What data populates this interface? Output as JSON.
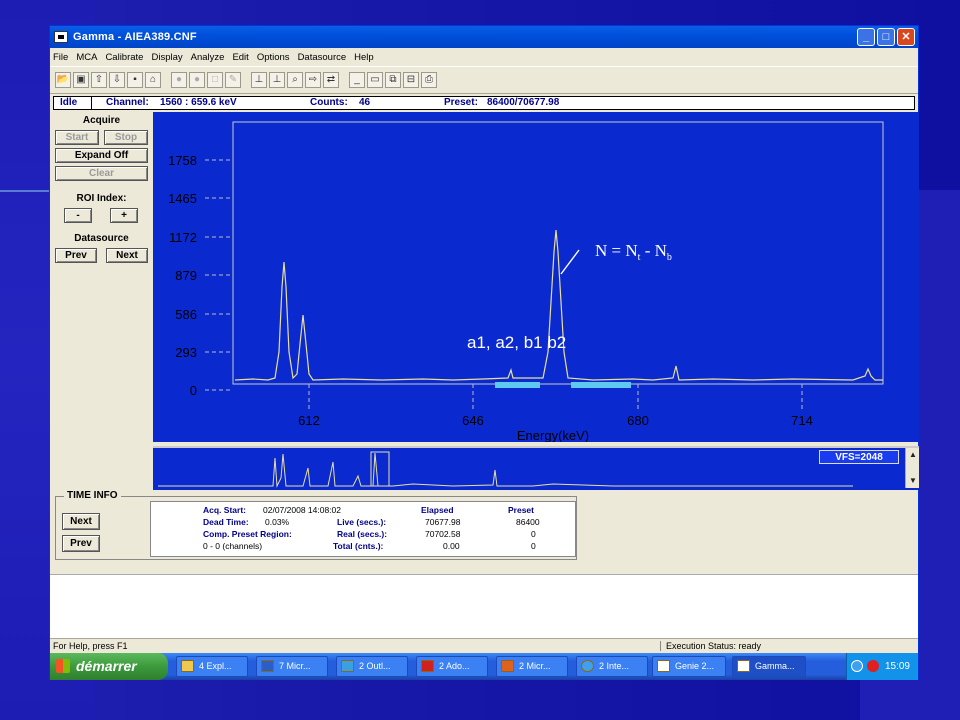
{
  "window": {
    "title": "Gamma - AIEA389.CNF",
    "controls": [
      "_",
      "□",
      "✕"
    ]
  },
  "menu": [
    "File",
    "MCA",
    "Calibrate",
    "Display",
    "Analyze",
    "Edit",
    "Options",
    "Datasource",
    "Help"
  ],
  "status_line": {
    "state": "Idle",
    "channel_label": "Channel:",
    "channel_value": "1560  :  659.6 keV",
    "counts_label": "Counts:",
    "counts_value": "46",
    "preset_label": "Preset:",
    "preset_value": "86400/70677.98"
  },
  "left_panel": {
    "acquire_label": "Acquire",
    "start": "Start",
    "stop": "Stop",
    "expand": "Expand Off",
    "clear": "Clear",
    "roi_label": "ROI Index:",
    "roi_minus": "-",
    "roi_plus": "+",
    "datasource_label": "Datasource",
    "prev": "Prev",
    "next": "Next"
  },
  "spectrum": {
    "y_ticks": [
      "1758",
      "1465",
      "1172",
      "879",
      "586",
      "293",
      "0"
    ],
    "x_ticks": [
      "612",
      "646",
      "680",
      "714"
    ],
    "xlabel": "Energy(keV)",
    "formula_text": "N = N",
    "formula_sub_t": "t",
    "formula_minus": " - N",
    "formula_sub_b": "b",
    "roi_labels": "a1,  a2,  b1  b2",
    "peak_color": "#e8e0a0",
    "roi_color": "#5ec8f0"
  },
  "overview": {
    "vfs": "VFS=2048"
  },
  "time_info": {
    "title": "TIME INFO",
    "next": "Next",
    "prev": "Prev",
    "acq_start_label": "Acq. Start:",
    "acq_start_value": "02/07/2008  14:08:02",
    "dead_time_label": "Dead Time:",
    "dead_time_value": "0.03%",
    "comp_preset_label": "Comp. Preset Region:",
    "channels_value": "0 - 0 (channels)",
    "elapsed_header": "Elapsed",
    "preset_header": "Preset",
    "live_label": "Live (secs.):",
    "live_elapsed": "70677.98",
    "live_preset": "86400",
    "real_label": "Real (secs.):",
    "real_elapsed": "70702.58",
    "real_preset": "0",
    "total_label": "Total (cnts.):",
    "total_elapsed": "0.00",
    "total_preset": "0"
  },
  "statusbar": {
    "help": "For Help, press F1",
    "execution": "Execution Status: ready"
  },
  "taskbar": {
    "start": "démarrer",
    "tasks": [
      "4 Expl...",
      "7 Micr...",
      "2 Outl...",
      "2 Ado...",
      "2 Micr...",
      "2 Inte...",
      "Genie 2...",
      "Gamma..."
    ],
    "clock": "15:09"
  }
}
